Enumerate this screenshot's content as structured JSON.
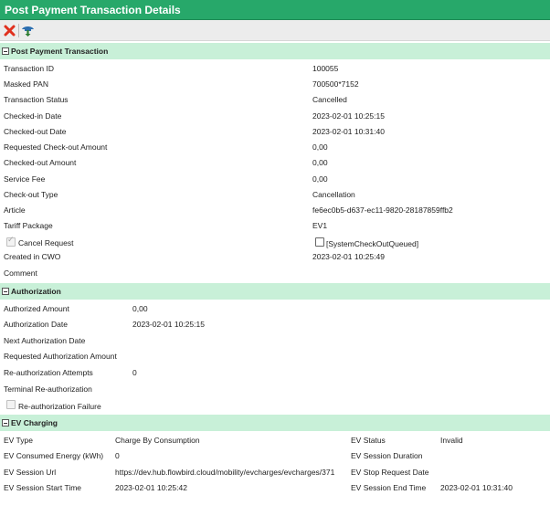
{
  "title": "Post Payment Transaction Details",
  "toolbar": {
    "icons": [
      "close-icon",
      "save-icon"
    ]
  },
  "sections": {
    "ppt": {
      "title": "Post Payment Transaction",
      "fields": [
        {
          "label": "Transaction ID",
          "value": "100055"
        },
        {
          "label": "Masked PAN",
          "value": "700500*7152"
        },
        {
          "label": "Transaction Status",
          "value": "Cancelled"
        },
        {
          "label": "Checked-in Date",
          "value": "2023-02-01 10:25:15"
        },
        {
          "label": "Checked-out Date",
          "value": "2023-02-01 10:31:40"
        },
        {
          "label": "Requested Check-out Amount",
          "value": "0,00"
        },
        {
          "label": "Checked-out Amount",
          "value": "0,00"
        },
        {
          "label": "Service Fee",
          "value": "0,00"
        },
        {
          "label": "Check-out Type",
          "value": "Cancellation"
        },
        {
          "label": "Article",
          "value": "fe6ec0b5-d637-ec11-9820-28187859ffb2"
        },
        {
          "label": "Tariff Package",
          "value": "EV1"
        }
      ],
      "cancel_request": {
        "label": "Cancel Request",
        "checked": true
      },
      "system_checkout": {
        "label": "[SystemCheckOutQueued]",
        "checked": false
      },
      "created_label": "Created in CWO",
      "created_value": "2023-02-01 10:25:49",
      "comment_label": "Comment"
    },
    "auth": {
      "title": "Authorization",
      "fields": [
        {
          "label": "Authorized Amount",
          "value": "0,00"
        },
        {
          "label": "Authorization Date",
          "value": "2023-02-01 10:25:15"
        },
        {
          "label": "Next Authorization Date",
          "value": ""
        },
        {
          "label": "Requested Authorization Amount",
          "value": ""
        },
        {
          "label": "Re-authorization Attempts",
          "value": "0"
        },
        {
          "label": "Terminal Re-authorization",
          "value": ""
        }
      ],
      "reauth_failure": {
        "label": "Re-authorization Failure",
        "checked": false
      }
    },
    "ev": {
      "title": "EV Charging",
      "left": [
        {
          "label": "EV Type",
          "value": "Charge By Consumption"
        },
        {
          "label": "EV Consumed Energy (kWh)",
          "value": "0"
        },
        {
          "label": "EV Session Url",
          "value": "https://dev.hub.flowbird.cloud/mobility/evcharges/evcharges/371"
        },
        {
          "label": "EV Session Start Time",
          "value": "2023-02-01 10:25:42"
        }
      ],
      "right": [
        {
          "label": "EV Status",
          "value": "Invalid"
        },
        {
          "label": "EV Session Duration",
          "value": ""
        },
        {
          "label": "EV Stop Request Date",
          "value": ""
        },
        {
          "label": "EV Session End Time",
          "value": "2023-02-01 10:31:40"
        }
      ]
    }
  },
  "colors": {
    "title_bar": "#27a86a",
    "section_header": "#c8f0d8",
    "close_icon": "#e0301e",
    "save_icon": "#2c6fb0"
  }
}
